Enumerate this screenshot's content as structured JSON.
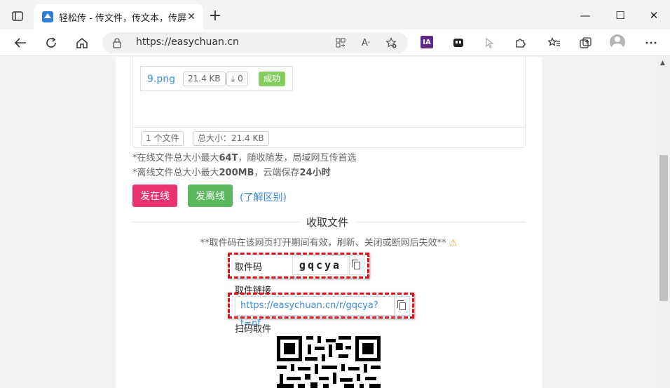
{
  "browser": {
    "tab_title": "轻松传 - 传文件，传文本，传屏幕",
    "tab_close": "✕",
    "new_tab": "+",
    "url": "https://easychuan.cn",
    "ext_ia_label": "IA",
    "win_minimize": "—",
    "win_maximize": "☐",
    "win_close": "✕"
  },
  "upload": {
    "file_name": "9.png",
    "file_size": "21.4 KB",
    "download_count": "0",
    "status": "成功",
    "file_count": "1 个文件",
    "total_size": "总大小：21.4 KB",
    "note_online_pre": "*在线文件总大小最大",
    "note_online_bold": "64T",
    "note_online_post": "，随收随发，局域网互传首选",
    "note_offline_pre": "*离线文件总大小最大",
    "note_offline_bold": "200MB",
    "note_offline_mid": "，云端保存",
    "note_offline_bold2": "24小时"
  },
  "actions": {
    "send_online": "发在线",
    "send_offline": "发离线",
    "learn_diff": "(了解区别)"
  },
  "receive": {
    "section_title": "收取文件",
    "note": "**取件码在该网页打开期间有效，刷新、关闭或断网后失效**",
    "warn_icon": "⚠",
    "code_label": "取件码",
    "code_value": "gqcya",
    "link_label": "取件链接",
    "link_value": "https://easychuan.cn/r/gqcya?t=nf",
    "qr_label": "扫码取件"
  },
  "colors": {
    "accent_link": "#3a8ee6",
    "btn_online": "#e8336e",
    "btn_offline": "#5cb85c",
    "success": "#85ce61",
    "highlight_dash": "#e0101a"
  }
}
